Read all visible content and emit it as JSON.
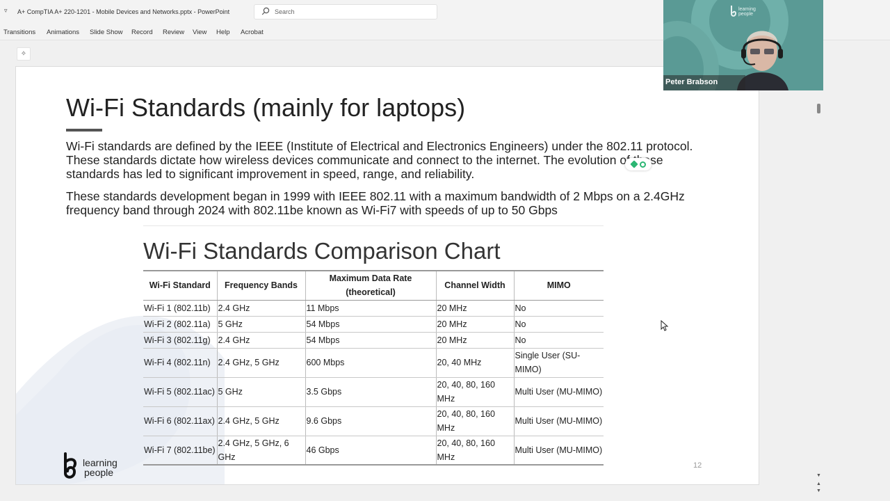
{
  "window": {
    "title": "A+ CompTIA A+ 220-1201 - Mobile Devices and Networks.pptx  -  PowerPoint",
    "search_placeholder": "Search"
  },
  "ribbon": {
    "tabs": [
      "Transitions",
      "Animations",
      "Slide Show",
      "Record",
      "Review",
      "View",
      "Help",
      "Acrobat"
    ]
  },
  "slide": {
    "title": "Wi-Fi Standards (mainly for laptops)",
    "paragraph1": "Wi-Fi standards are defined by the IEEE (Institute of Electrical and Electronics Engineers) under the 802.11 protocol. These standards dictate how wireless devices communicate and connect to the internet. The evolution of these standards has led to significant improvement in speed, range, and reliability.",
    "paragraph2": "These standards development began in 1999 with IEEE 802.11 with a maximum bandwidth of 2 Mbps on a 2.4GHz frequency band through 2024 with 802.11be known as Wi-Fi7 with speeds of up to 50 Gbps",
    "chart_title": "Wi-Fi Standards Comparison Chart",
    "table": {
      "headers": [
        "Wi-Fi Standard",
        "Frequency Bands",
        "Maximum Data Rate (theoretical)",
        "Channel Width",
        "MIMO"
      ],
      "rows": [
        [
          "Wi-Fi 1 (802.11b)",
          "2.4 GHz",
          "11 Mbps",
          "20 MHz",
          "No"
        ],
        [
          "Wi-Fi 2 (802.11a)",
          "5 GHz",
          "54 Mbps",
          "20 MHz",
          "No"
        ],
        [
          "Wi-Fi 3 (802.11g)",
          "2.4 GHz",
          "54 Mbps",
          "20 MHz",
          "No"
        ],
        [
          "Wi-Fi 4 (802.11n)",
          "2.4 GHz, 5 GHz",
          "600 Mbps",
          "20, 40 MHz",
          "Single User (SU-MIMO)"
        ],
        [
          "Wi-Fi 5 (802.11ac)",
          "5 GHz",
          "3.5 Gbps",
          "20, 40, 80, 160 MHz",
          "Multi User (MU-MIMO)"
        ],
        [
          "Wi-Fi 6 (802.11ax)",
          "2.4 GHz, 5 GHz",
          "9.6 Gbps",
          "20, 40, 80, 160 MHz",
          "Multi User (MU-MIMO)"
        ],
        [
          "Wi-Fi 7 (802.11be)",
          "2.4 GHz, 5 GHz, 6 GHz",
          "46 Gbps",
          "20, 40, 80, 160 MHz",
          "Multi User (MU-MIMO)"
        ]
      ]
    },
    "logo_line1": "learning",
    "logo_line2": "people",
    "page_number": "12"
  },
  "webcam": {
    "presenter_name": "Peter Brabson",
    "logo_line1": "learning",
    "logo_line2": "people"
  },
  "colors": {
    "accent_green": "#2bb673",
    "webcam_teal": "#5a9a95"
  }
}
